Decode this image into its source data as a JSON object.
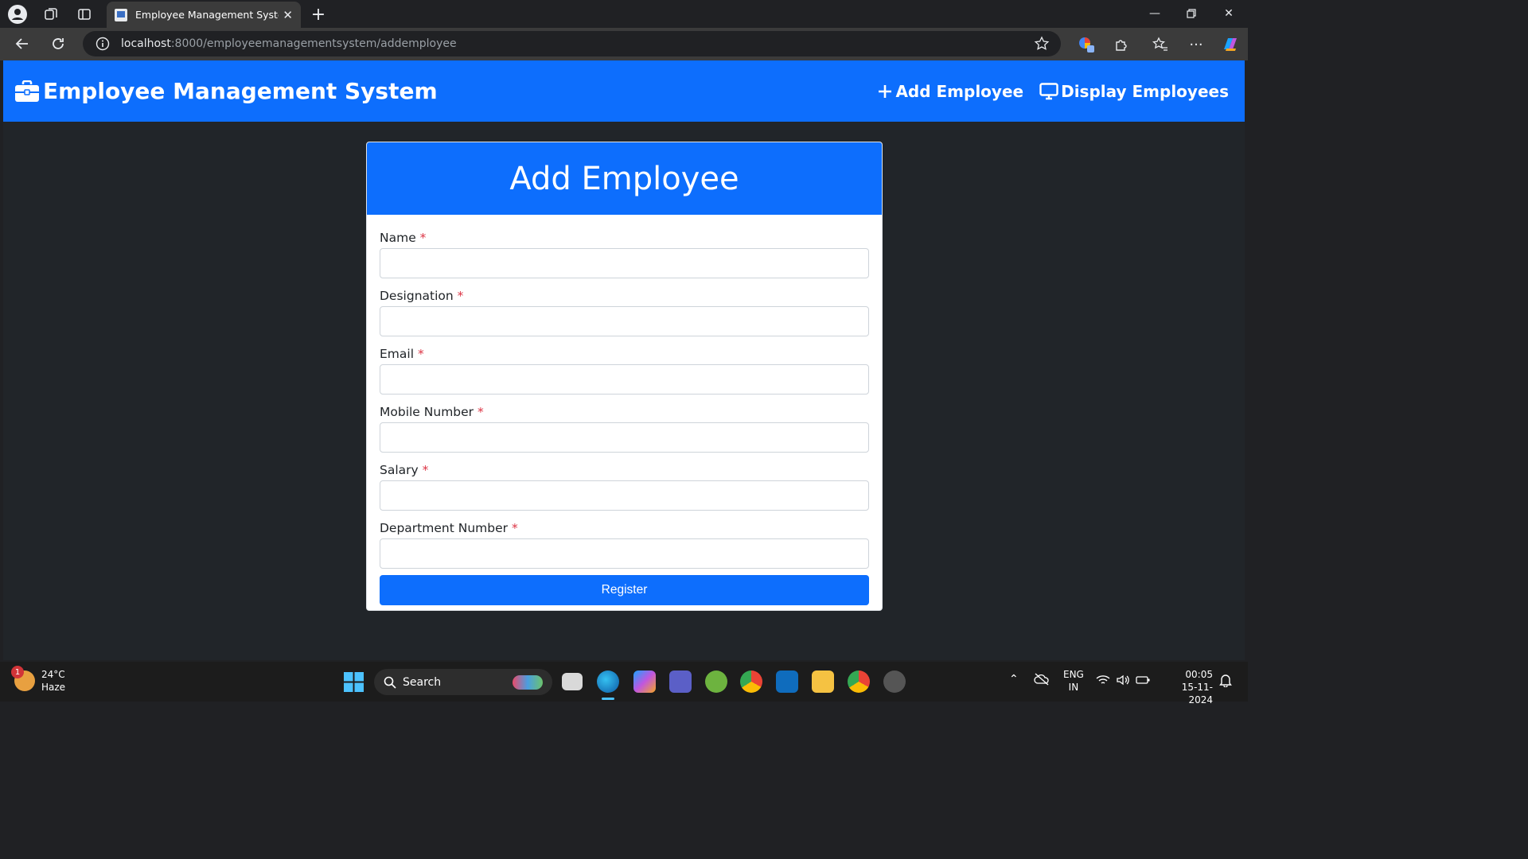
{
  "browser": {
    "tab_title": "Employee Management System - ",
    "url_host": "localhost",
    "url_path": ":8000/employeemanagementsystem/addemployee"
  },
  "navbar": {
    "brand": "Employee Management System",
    "add_link": "Add Employee",
    "display_link": "Display Employees"
  },
  "form": {
    "title": "Add Employee",
    "required_mark": "*",
    "fields": [
      {
        "label": "Name"
      },
      {
        "label": "Designation"
      },
      {
        "label": "Email"
      },
      {
        "label": "Mobile Number"
      },
      {
        "label": "Salary"
      },
      {
        "label": "Department Number"
      }
    ],
    "submit": "Register"
  },
  "taskbar": {
    "weather_badge": "1",
    "temperature": "24°C",
    "condition": "Haze",
    "search": "Search",
    "lang": "ENG",
    "region": "IN",
    "time": "00:05",
    "date": "15-11-2024"
  }
}
